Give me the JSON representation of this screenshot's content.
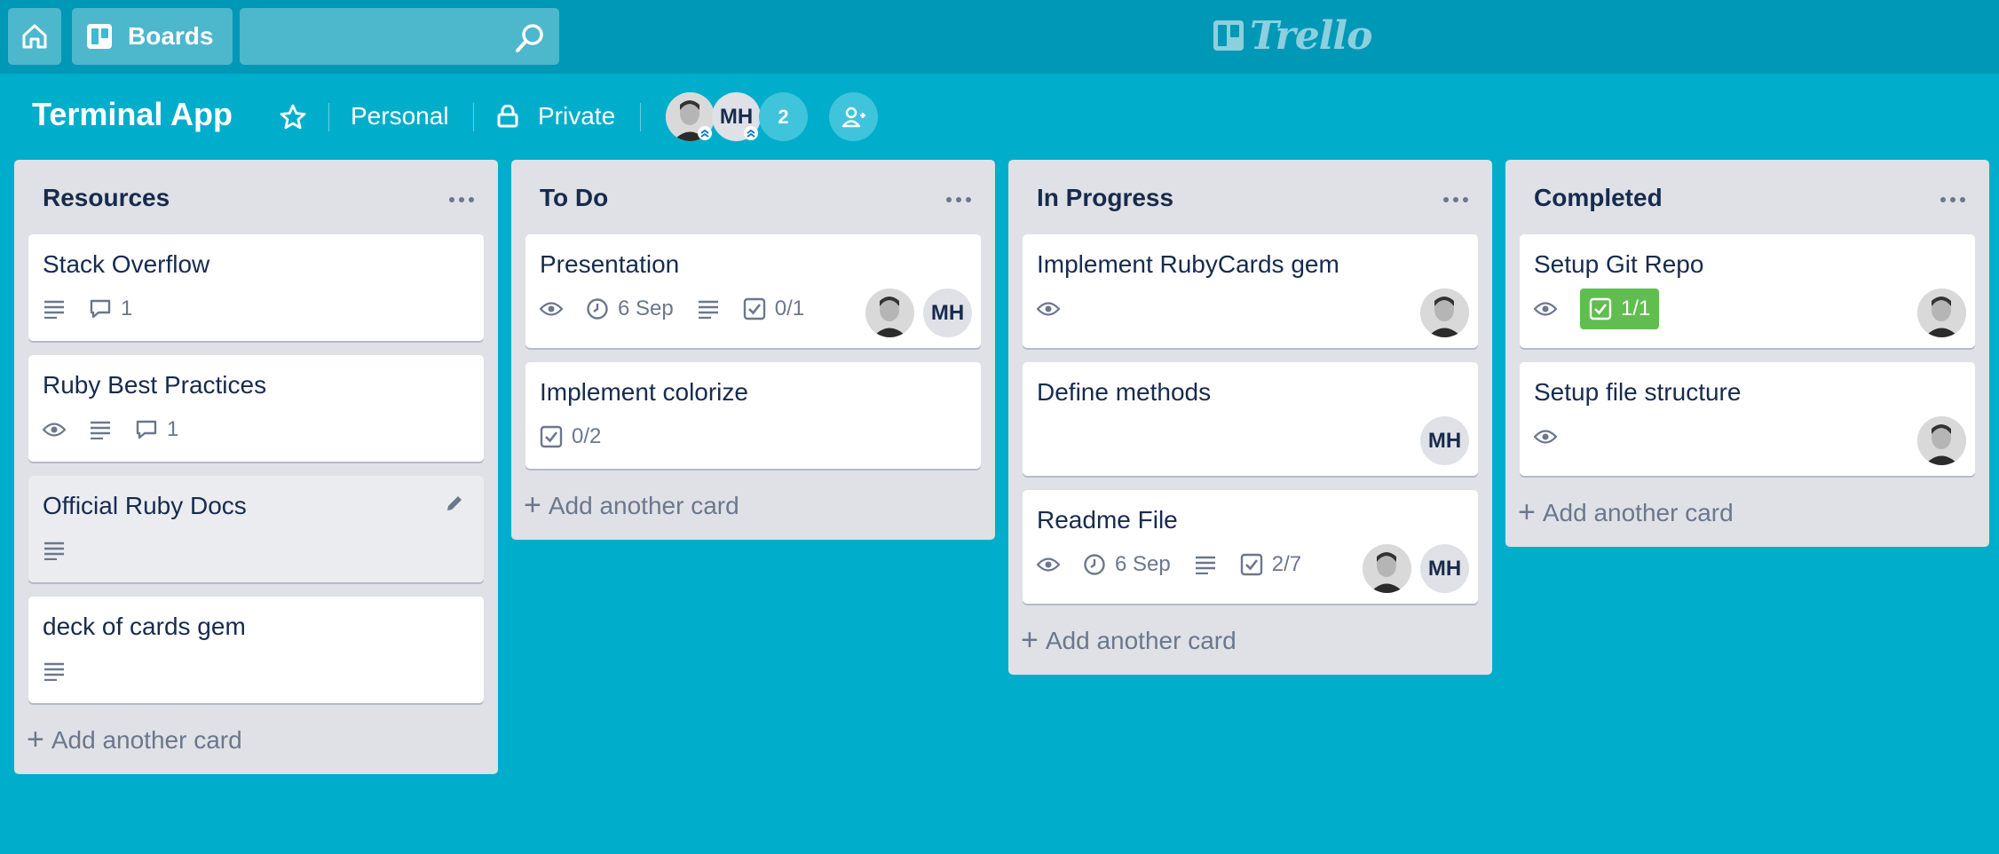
{
  "nav": {
    "boards_label": "Boards",
    "search_placeholder": "",
    "logo_text": "Trello"
  },
  "board": {
    "title": "Terminal App",
    "team_label": "Personal",
    "visibility_label": "Private",
    "members": [
      {
        "type": "photo",
        "initials": ""
      },
      {
        "type": "initials",
        "initials": "MH"
      },
      {
        "type": "count",
        "initials": "2"
      }
    ]
  },
  "lists": [
    {
      "title": "Resources",
      "add_label": "Add another card",
      "cards": [
        {
          "title": "Stack Overflow",
          "badges": [
            {
              "icon": "description-icon"
            },
            {
              "icon": "comment-icon",
              "text": "1"
            }
          ],
          "members": []
        },
        {
          "title": "Ruby Best Practices",
          "badges": [
            {
              "icon": "watch-icon"
            },
            {
              "icon": "description-icon"
            },
            {
              "icon": "comment-icon",
              "text": "1"
            }
          ],
          "members": []
        },
        {
          "title": "Official Ruby Docs",
          "badges": [
            {
              "icon": "description-icon"
            }
          ],
          "members": [],
          "hover": true
        },
        {
          "title": "deck of cards gem",
          "badges": [
            {
              "icon": "description-icon"
            }
          ],
          "members": []
        }
      ]
    },
    {
      "title": "To Do",
      "add_label": "Add another card",
      "cards": [
        {
          "title": "Presentation",
          "badges": [
            {
              "icon": "watch-icon"
            },
            {
              "icon": "clock-icon",
              "text": "6 Sep"
            },
            {
              "icon": "description-icon"
            },
            {
              "icon": "checklist-icon",
              "text": "0/1"
            }
          ],
          "members": [
            "photo",
            "MH"
          ]
        },
        {
          "title": "Implement colorize",
          "badges": [
            {
              "icon": "checklist-icon",
              "text": "0/2"
            }
          ],
          "members": []
        }
      ]
    },
    {
      "title": "In Progress",
      "add_label": "Add another card",
      "cards": [
        {
          "title": "Implement RubyCards gem",
          "badges": [
            {
              "icon": "watch-icon"
            }
          ],
          "members": [
            "photo"
          ]
        },
        {
          "title": "Define methods",
          "badges": [],
          "members": [
            "MH"
          ]
        },
        {
          "title": "Readme File",
          "badges": [
            {
              "icon": "watch-icon"
            },
            {
              "icon": "clock-icon",
              "text": "6 Sep"
            },
            {
              "icon": "description-icon"
            },
            {
              "icon": "checklist-icon",
              "text": "2/7"
            }
          ],
          "members": [
            "photo",
            "MH"
          ]
        }
      ]
    },
    {
      "title": "Completed",
      "add_label": "Add another card",
      "cards": [
        {
          "title": "Setup Git Repo",
          "badges": [
            {
              "icon": "watch-icon"
            },
            {
              "icon": "checklist-icon",
              "text": "1/1",
              "complete": true
            }
          ],
          "members": [
            "photo"
          ]
        },
        {
          "title": "Setup file structure",
          "badges": [
            {
              "icon": "watch-icon"
            }
          ],
          "members": [
            "photo"
          ]
        }
      ]
    }
  ],
  "colors": {
    "board_bg": "#00aecc",
    "topbar_bg": "#0098b7",
    "list_bg": "#dfe1e6",
    "checklist_complete": "#61bd4f"
  }
}
